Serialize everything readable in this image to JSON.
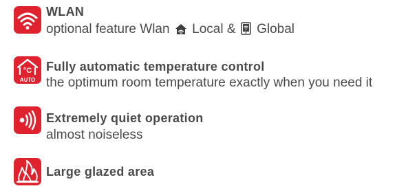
{
  "features": [
    {
      "icon": "wifi-icon",
      "title": "WLAN",
      "subtitle_prefix": "optional feature Wlan",
      "subtitle_local": "Local &",
      "subtitle_global": "Global",
      "inline_icons": [
        "home-icon",
        "phone-wifi-icon"
      ]
    },
    {
      "icon": "thermometer-auto-icon",
      "icon_text_top": "°C",
      "icon_text_bottom": "AUTO",
      "title": "Fully automatic temperature control",
      "subtitle": "the optimum room temperature exactly when you need it"
    },
    {
      "icon": "sound-waves-icon",
      "title": "Extremely quiet operation",
      "subtitle": "almost noiseless"
    },
    {
      "icon": "flame-icon",
      "title": "Large glazed area",
      "subtitle": ""
    }
  ],
  "colors": {
    "accent": "#e0222f",
    "text": "#4a4a4a"
  }
}
